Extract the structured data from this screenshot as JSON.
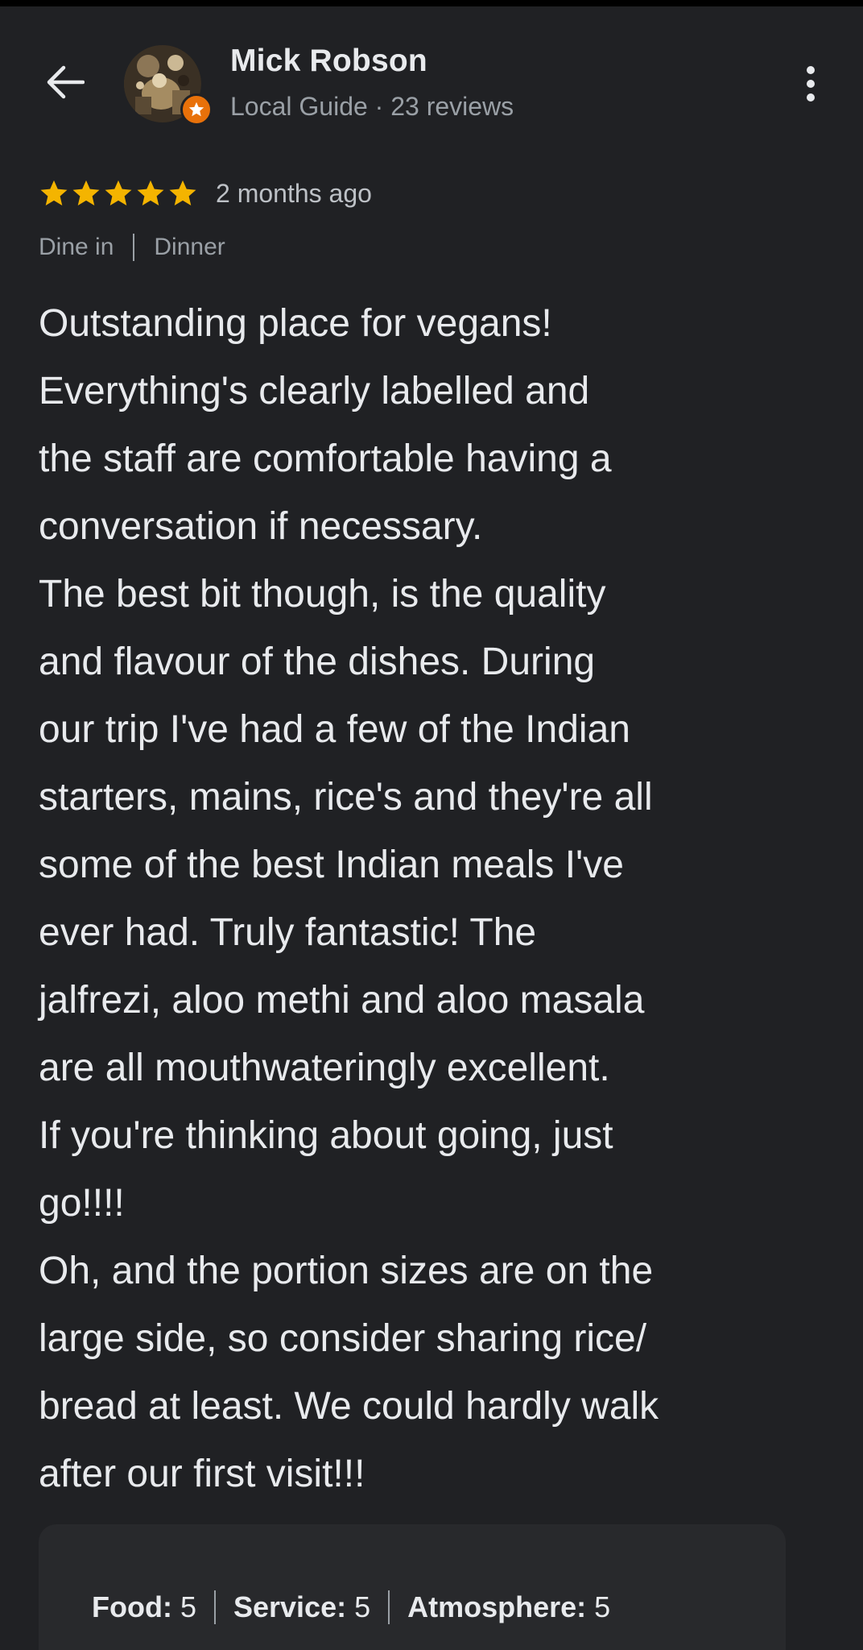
{
  "header": {
    "user_name": "Mick Robson",
    "user_meta": "Local Guide · 23 reviews",
    "back_icon": "arrow-left-icon",
    "more_icon": "more-vert-icon"
  },
  "review": {
    "stars": 5,
    "stars_max": 5,
    "date": "2 months ago",
    "tags": [
      "Dine in",
      "Dinner"
    ],
    "text_lines": [
      "Outstanding place for vegans!",
      "Everything's clearly labelled and",
      "the staff are comfortable having a",
      "conversation if necessary.",
      "The best bit though, is the quality",
      "and flavour of the dishes. During",
      "our trip I've had a few of the Indian",
      "starters, mains, rice's and they're all",
      "some of the best Indian meals I've",
      "ever had. Truly fantastic! The",
      "jalfrezi, aloo methi and aloo masala",
      "are all mouthwateringly excellent.",
      "If you're thinking about going, just",
      "go!!!!",
      "Oh, and the portion sizes are on the",
      "large side, so consider sharing rice/",
      "bread at least. We could hardly walk",
      "after our first visit!!!"
    ]
  },
  "ratings": {
    "food_label": "Food:",
    "food_value": "5",
    "service_label": "Service:",
    "service_value": "5",
    "atmosphere_label": "Atmosphere:",
    "atmosphere_value": "5"
  },
  "colors": {
    "background": "#202124",
    "star": "#f4b400",
    "badge": "#e8710a",
    "text_primary": "#e8eaed",
    "text_secondary": "#9aa0a6"
  }
}
